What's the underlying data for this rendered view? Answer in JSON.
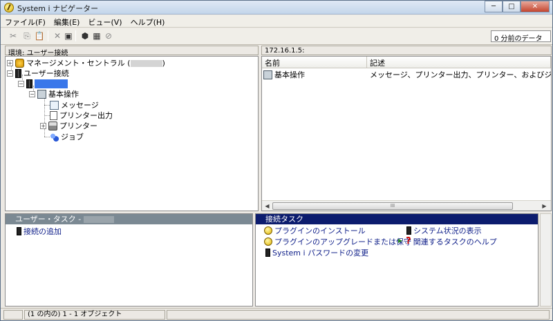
{
  "window": {
    "title": "System i ナビゲーター",
    "minimize": "─",
    "maximize": "□",
    "close": "✕"
  },
  "menu": [
    {
      "label": "ファイル(F)"
    },
    {
      "label": "編集(E)"
    },
    {
      "label": "ビュー(V)"
    },
    {
      "label": "ヘルプ(H)"
    }
  ],
  "toolbar": {
    "cut_icon": "✂",
    "copy_icon": "⎘",
    "paste_icon": "📋",
    "delete_icon": "✕",
    "properties_icon": "▣",
    "connect_icon": "⬢",
    "view_icon": "▦",
    "stop_icon": "⊘",
    "data_age": "0 分前のデータ"
  },
  "left_header": "環境: ユーザー接続",
  "tree": {
    "mgmt_central": "マネージメント・セントラル (",
    "mgmt_central_close": ")",
    "user_connections": "ユーザー接続",
    "basic_ops": "基本操作",
    "messages": "メッセージ",
    "printer_output": "プリンター出力",
    "printers": "プリンター",
    "jobs": "ジョブ"
  },
  "right_header": "172.16.1.5:",
  "list": {
    "col_name": "名前",
    "col_desc": "記述",
    "row_name": "基本操作",
    "row_desc": "メッセージ、プリンター出力、プリンター、およびジョブを管"
  },
  "scroll_grip": "III",
  "user_tasks": {
    "header": "ユーザー・タスク -",
    "add_connection": "接続の追加"
  },
  "connection_tasks": {
    "header": "接続タスク",
    "install_plugins": "プラグインのインストール",
    "upgrade_plugins": "プラグインのアップグレードまたは保守",
    "change_password": "System i パスワードの変更",
    "show_status": "システム状況の表示",
    "related_help": "関連するタスクのヘルプ"
  },
  "status": {
    "objects": "(1 の内の) 1 - 1 オブジェクト"
  }
}
